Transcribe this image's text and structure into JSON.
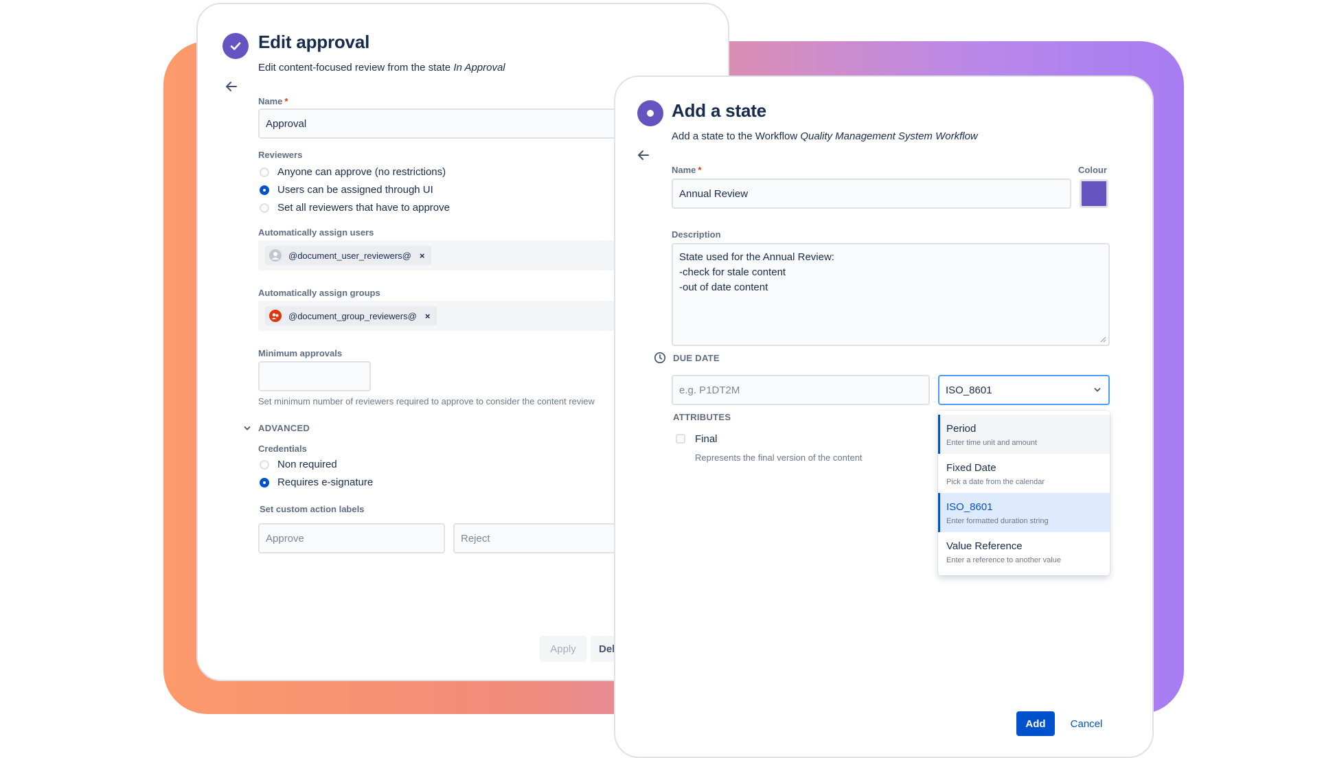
{
  "colors": {
    "accent": "#6554c0",
    "primary": "#0052cc",
    "required": "#de350b"
  },
  "edit_approval": {
    "title": "Edit approval",
    "subtitle_prefix": "Edit content-focused review from the state",
    "subtitle_state": "In Approval",
    "name_label": "Name",
    "name_value": "Approval",
    "reviewers_label": "Reviewers",
    "reviewer_options": [
      {
        "label": "Anyone can approve (no restrictions)",
        "selected": false
      },
      {
        "label": "Users can be assigned through UI",
        "selected": true
      },
      {
        "label": "Set all reviewers that have to approve",
        "selected": false
      }
    ],
    "auto_users_label": "Automatically assign users",
    "auto_users_chip": "@document_user_reviewers@",
    "auto_groups_label": "Automatically assign groups",
    "auto_groups_chip": "@document_group_reviewers@",
    "min_approvals_label": "Minimum approvals",
    "min_approvals_value": "",
    "min_approvals_help": "Set minimum number of reviewers required to approve to consider the content review",
    "advanced_label": "ADVANCED",
    "credentials_label": "Credentials",
    "credential_options": [
      {
        "label": "Non required",
        "selected": false
      },
      {
        "label": "Requires e-signature",
        "selected": true
      }
    ],
    "custom_labels_label": "Set custom action labels",
    "approve_placeholder": "Approve",
    "reject_placeholder": "Reject",
    "apply_label": "Apply",
    "delete_label_partial": "Del"
  },
  "add_state": {
    "title": "Add a state",
    "subtitle_prefix": "Add a state to the Workflow",
    "subtitle_workflow": "Quality Management System Workflow",
    "name_label": "Name",
    "name_value": "Annual Review",
    "colour_label": "Colour",
    "colour_value": "#6554c0",
    "description_label": "Description",
    "description_lines": [
      "State used for the Annual Review:",
      "-check for stale content",
      "-out of date content"
    ],
    "due_date_label": "DUE DATE",
    "due_date_placeholder": "e.g. P1DT2M",
    "format_selected": "ISO_8601",
    "format_options": [
      {
        "title": "Period",
        "desc": "Enter time unit and amount"
      },
      {
        "title": "Fixed Date",
        "desc": "Pick a date from the calendar"
      },
      {
        "title": "ISO_8601",
        "desc": "Enter formatted duration string"
      },
      {
        "title": "Value Reference",
        "desc": "Enter a reference to another value"
      }
    ],
    "attributes_label": "ATTRIBUTES",
    "final_label": "Final",
    "final_checked": false,
    "final_help": "Represents the final version of the content",
    "add_label": "Add",
    "cancel_label": "Cancel"
  }
}
